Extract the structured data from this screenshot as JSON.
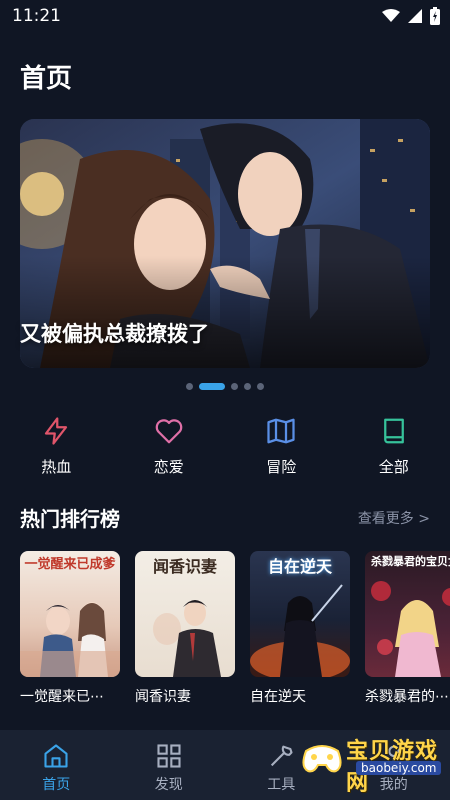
{
  "status_bar": {
    "time": "11:21"
  },
  "page": {
    "title": "首页"
  },
  "banner": {
    "caption": "又被偏执总裁撩拨了",
    "page_count": 5,
    "active_page": 2
  },
  "categories": [
    {
      "label": "热血",
      "icon": "lightning-icon",
      "color": "#e0556a"
    },
    {
      "label": "恋爱",
      "icon": "heart-icon",
      "color": "#e070a8"
    },
    {
      "label": "冒险",
      "icon": "map-icon",
      "color": "#5a8fe6"
    },
    {
      "label": "全部",
      "icon": "book-icon",
      "color": "#36c29a"
    }
  ],
  "ranking": {
    "title": "热门排行榜",
    "more": "查看更多 >",
    "books": [
      {
        "title": "一觉醒来已⋯",
        "cover_title": "一觉醒来已成爹"
      },
      {
        "title": "闻香识妻",
        "cover_title": "闻香识妻"
      },
      {
        "title": "自在逆天",
        "cover_title": "自在逆天"
      },
      {
        "title": "杀戮暴君的⋯",
        "cover_title": "杀戮暴君的宝贝女"
      }
    ]
  },
  "bottom_nav": [
    {
      "label": "首页",
      "icon": "home-icon",
      "active": true
    },
    {
      "label": "发现",
      "icon": "grid-icon",
      "active": false
    },
    {
      "label": "工具",
      "icon": "wrench-icon",
      "active": false
    },
    {
      "label": "我的",
      "icon": "user-icon",
      "active": false
    }
  ],
  "watermark": {
    "text": "宝贝游戏网",
    "url": "baobeiy.com"
  },
  "colors": {
    "background": "#101624",
    "accent": "#3aa3e8",
    "nav_background": "#1a2232"
  }
}
